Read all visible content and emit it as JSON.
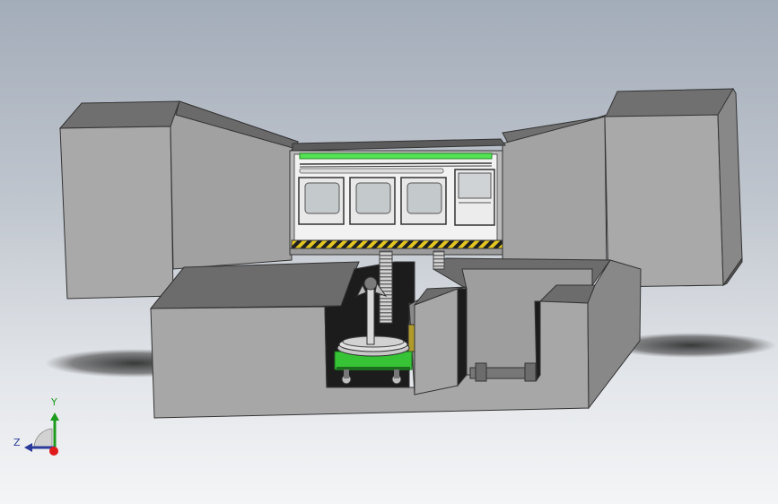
{
  "viewport": {
    "background_top": "#a3acb9",
    "background_bottom": "#f4f5f7"
  },
  "colors": {
    "housing_front": "#a5a5a5",
    "housing_side": "#8a8a8a",
    "housing_top": "#6e6e6e",
    "accent_green": "#2db82d",
    "light_bar": "#53e353",
    "hazard_yellow": "#e2c520",
    "hazard_black": "#202020",
    "cart_green": "#36c336"
  },
  "triad": {
    "y_label": "Y",
    "z_label": "Z",
    "x_color": "#e01a1a",
    "y_color": "#1c9a1c",
    "z_color": "#2c3a9a"
  }
}
